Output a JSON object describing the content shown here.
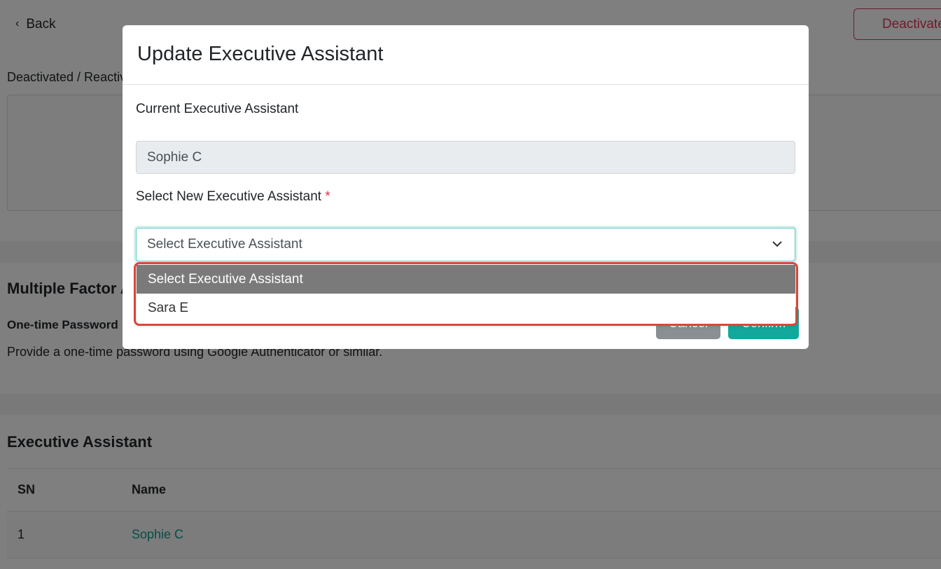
{
  "topbar": {
    "back_label": "Back",
    "deactivate_label": "Deactivate"
  },
  "page": {
    "breadcrumb": "Deactivated / Reactivated",
    "mfa": {
      "title": "Multiple Factor Authentication",
      "otp_title": "One-time Password",
      "otp_desc": "Provide a one-time password using Google Authenticator or similar."
    },
    "ea": {
      "title": "Executive Assistant",
      "columns": [
        "SN",
        "Name"
      ],
      "rows": [
        {
          "sn": "1",
          "name": "Sophie C"
        }
      ]
    }
  },
  "modal": {
    "title": "Update Executive Assistant",
    "current_label": "Current Executive Assistant",
    "current_value": "Sophie C",
    "new_label": "Select New Executive Assistant",
    "required_mark": "*",
    "select_value": "Select Executive Assistant",
    "options": [
      "Select Executive Assistant",
      "Sara E"
    ],
    "cancel_label": "Cancel",
    "confirm_label": "Confirm"
  },
  "colors": {
    "accent": "#12a89b",
    "danger": "#e0345e",
    "highlight": "#d9473a"
  }
}
